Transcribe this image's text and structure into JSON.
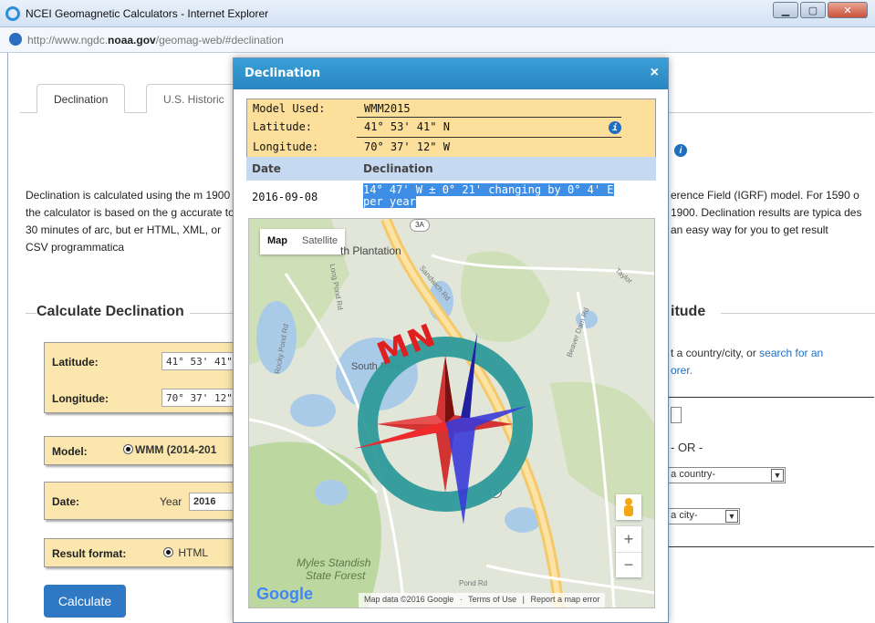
{
  "window": {
    "title": "NCEI Geomagnetic Calculators - Internet Explorer",
    "url_prefix": "http://www.ngdc.",
    "url_domain": "noaa.gov",
    "url_suffix": "/geomag-web/#declination"
  },
  "tabs": [
    {
      "label": "Declination"
    },
    {
      "label": "U.S. Historic"
    }
  ],
  "page": {
    "desc_left": "Declination is calculated using the m 1900 the calculator is based on the g accurate to 30 minutes of arc, but er HTML, XML, or CSV programmatica",
    "desc_right": "erence Field (IGRF) model. For 1590 o 1900. Declination results are typica des an easy way for you to get result",
    "calc_legend": "Calculate Declination",
    "right_legend": "itude",
    "right_text": "t a country/city, or ",
    "right_link": "search for an",
    "right_link2": "orer.",
    "latitude_label": "Latitude:",
    "latitude_value": "41° 53' 41\"",
    "longitude_label": "Longitude:",
    "longitude_value": "70° 37' 12\"",
    "model_label": "Model:",
    "model_value": "WMM (2014-201",
    "date_label": "Date:",
    "date_year_label": "Year",
    "date_year_value": "2016",
    "format_label": "Result format:",
    "format_value": "HTML",
    "calculate_button": "Calculate",
    "or_label": "- OR -",
    "country_select": "e a country-",
    "city_select": "e a city-"
  },
  "modal": {
    "title": "Declination",
    "close": "×",
    "model_label": "Model Used:",
    "model_value": "WMM2015",
    "lat_label": "Latitude:",
    "lat_value": "41° 53' 41\" N",
    "lon_label": "Longitude:",
    "lon_value": "70° 37' 12\" W",
    "col_date": "Date",
    "col_decl": "Declination",
    "result_date": "2016-09-08",
    "result_decl_line1": "14° 47' W  ± 0° 21'  changing by  0° 4' E",
    "result_decl_line2": "per year"
  },
  "map": {
    "btn_map": "Map",
    "btn_satellite": "Satellite",
    "label_plantation": "th Plantation",
    "label_south_pond": "South Pond",
    "label_myles": "Myles Standish",
    "label_state_forest": "State Forest",
    "label_route3a": "3A",
    "label_route3": "3",
    "label_pond_rd": "Pond Rd",
    "label_sandwich": "Sandwich Rd",
    "label_beaver": "Beaver Dam Rd",
    "label_long_pond": "Long Pond Rd",
    "label_rocky": "Rocky Pond Rd",
    "label_taylor": "Taylor",
    "compass_label": "MN",
    "google": "Google",
    "attribution_data": "Map data ©2016 Google",
    "attribution_terms": "Terms of Use",
    "attribution_report": "Report a map error",
    "zoom_in": "+",
    "zoom_out": "−"
  }
}
